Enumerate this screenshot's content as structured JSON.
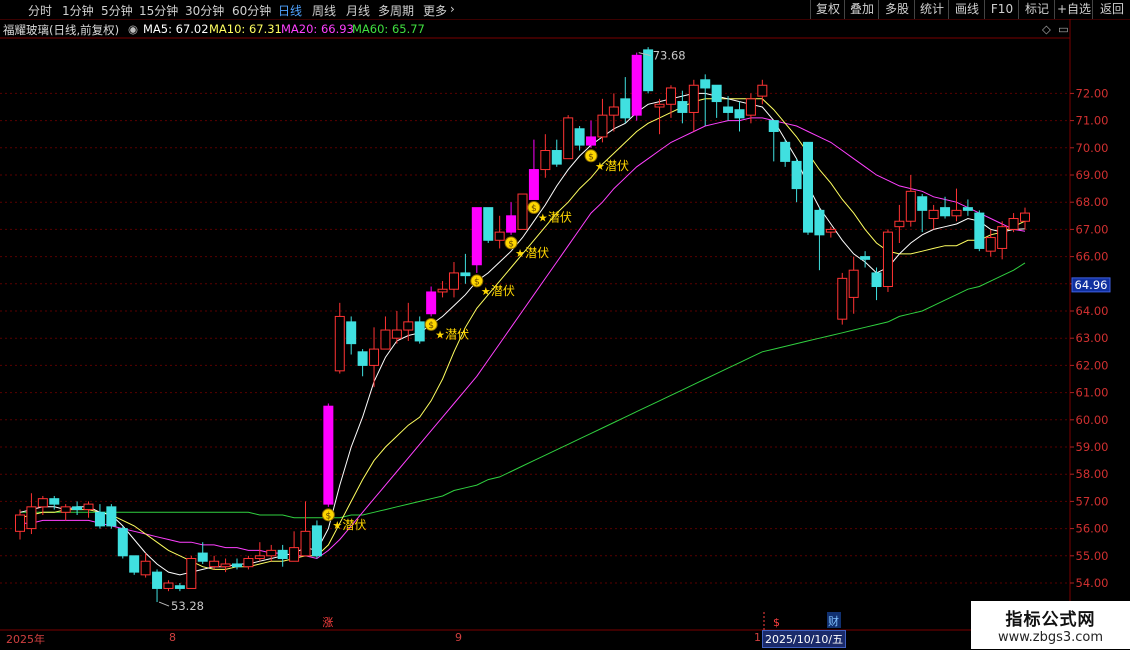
{
  "toolbar": {
    "period_tabs": [
      "分时",
      "1分钟",
      "5分钟",
      "15分钟",
      "30分钟",
      "60分钟",
      "日线",
      "周线",
      "月线",
      "多周期",
      "更多"
    ],
    "active_tab": "日线",
    "right_buttons": [
      "复权",
      "叠加",
      "多股",
      "统计",
      "画线",
      "F10",
      "标记",
      "+自选",
      "返回"
    ]
  },
  "stock": {
    "title": "福耀玻璃(日线,前复权)"
  },
  "ma_legend": [
    {
      "label": "MA5: 67.02",
      "color": "#ffffff"
    },
    {
      "label": "MA10: 67.31",
      "color": "#ffff60"
    },
    {
      "label": "MA20: 66.93",
      "color": "#ff40ff"
    },
    {
      "label": "MA60: 65.77",
      "color": "#40e040"
    }
  ],
  "price_axis": {
    "labels": [
      "72.00",
      "71.00",
      "70.00",
      "69.00",
      "68.00",
      "67.00",
      "66.00",
      "65.00",
      "64.00",
      "63.00",
      "62.00",
      "61.00",
      "60.00",
      "59.00",
      "58.00",
      "57.00",
      "56.00",
      "55.00",
      "54.00"
    ],
    "current_price": "64.96"
  },
  "annotations": {
    "high_label": "73.68",
    "low_label": "53.28",
    "signal_label": "潜伏",
    "zhang_label": "涨",
    "cai_label": "财",
    "s_label": "$"
  },
  "date_axis": {
    "labels": [
      "2025年",
      "8",
      "9",
      "1"
    ],
    "cursor_date": "2025/10/10/五"
  },
  "watermark": {
    "line1": "指标公式网",
    "line2": "www.zbgs3.com"
  },
  "colors": {
    "up": "#ff3333",
    "down": "#40e0e0",
    "highlight": "#ff00ff",
    "signal": "#ffd700"
  },
  "chart_data": {
    "type": "candlestick",
    "title": "福耀玻璃(日线,前复权)",
    "ylim": [
      53.5,
      73.9
    ],
    "candles": [
      {
        "o": 55.9,
        "c": 56.5,
        "h": 56.7,
        "l": 55.6
      },
      {
        "o": 56.0,
        "c": 56.8,
        "h": 57.3,
        "l": 55.8
      },
      {
        "o": 56.8,
        "c": 57.1,
        "h": 57.2,
        "l": 56.5
      },
      {
        "o": 57.1,
        "c": 56.9,
        "h": 57.2,
        "l": 56.7
      },
      {
        "o": 56.6,
        "c": 56.8,
        "h": 56.9,
        "l": 56.3
      },
      {
        "o": 56.8,
        "c": 56.7,
        "h": 57.0,
        "l": 56.5
      },
      {
        "o": 56.7,
        "c": 56.9,
        "h": 57.0,
        "l": 56.4
      },
      {
        "o": 56.6,
        "c": 56.1,
        "h": 56.9,
        "l": 56.0
      },
      {
        "o": 56.8,
        "c": 56.1,
        "h": 56.9,
        "l": 56.0
      },
      {
        "o": 56.0,
        "c": 55.0,
        "h": 56.1,
        "l": 54.9
      },
      {
        "o": 55.0,
        "c": 54.4,
        "h": 55.0,
        "l": 54.3
      },
      {
        "o": 54.3,
        "c": 54.8,
        "h": 55.1,
        "l": 54.2
      },
      {
        "o": 54.4,
        "c": 53.8,
        "h": 54.5,
        "l": 53.3
      },
      {
        "o": 53.8,
        "c": 54.0,
        "h": 54.1,
        "l": 53.7
      },
      {
        "o": 53.9,
        "c": 53.8,
        "h": 54.0,
        "l": 53.7
      },
      {
        "o": 53.8,
        "c": 54.9,
        "h": 55.0,
        "l": 53.8
      },
      {
        "o": 55.1,
        "c": 54.8,
        "h": 55.5,
        "l": 54.7
      },
      {
        "o": 54.6,
        "c": 54.8,
        "h": 55.0,
        "l": 54.5
      },
      {
        "o": 54.6,
        "c": 54.7,
        "h": 54.9,
        "l": 54.4
      },
      {
        "o": 54.7,
        "c": 54.6,
        "h": 54.9,
        "l": 54.5
      },
      {
        "o": 54.6,
        "c": 54.9,
        "h": 55.0,
        "l": 54.5
      },
      {
        "o": 54.9,
        "c": 55.0,
        "h": 55.5,
        "l": 54.8
      },
      {
        "o": 55.0,
        "c": 55.2,
        "h": 55.4,
        "l": 54.8
      },
      {
        "o": 55.2,
        "c": 54.9,
        "h": 55.4,
        "l": 54.6
      },
      {
        "o": 54.8,
        "c": 55.3,
        "h": 55.9,
        "l": 54.8
      },
      {
        "o": 55.0,
        "c": 55.9,
        "h": 57.0,
        "l": 55.0
      },
      {
        "o": 56.1,
        "c": 55.0,
        "h": 56.3,
        "l": 54.9
      },
      {
        "o": 56.9,
        "c": 60.5,
        "h": 60.6,
        "l": 56.8
      },
      {
        "o": 61.8,
        "c": 63.8,
        "h": 64.3,
        "l": 61.7
      },
      {
        "o": 63.6,
        "c": 62.8,
        "h": 63.8,
        "l": 62.4
      },
      {
        "o": 62.5,
        "c": 62.0,
        "h": 62.6,
        "l": 61.6
      },
      {
        "o": 62.0,
        "c": 62.6,
        "h": 63.4,
        "l": 61.2
      },
      {
        "o": 62.6,
        "c": 63.3,
        "h": 63.8,
        "l": 62.6
      },
      {
        "o": 63.0,
        "c": 63.3,
        "h": 64.0,
        "l": 62.8
      },
      {
        "o": 63.3,
        "c": 63.6,
        "h": 64.3,
        "l": 62.9
      },
      {
        "o": 63.6,
        "c": 62.9,
        "h": 63.8,
        "l": 62.8
      },
      {
        "o": 63.9,
        "c": 64.7,
        "h": 64.9,
        "l": 63.8
      },
      {
        "o": 64.7,
        "c": 64.8,
        "h": 65.1,
        "l": 64.5
      },
      {
        "o": 64.8,
        "c": 65.4,
        "h": 65.8,
        "l": 64.5
      },
      {
        "o": 65.4,
        "c": 65.3,
        "h": 66.1,
        "l": 65.0
      },
      {
        "o": 65.7,
        "c": 67.8,
        "h": 67.8,
        "l": 65.4
      },
      {
        "o": 67.8,
        "c": 66.6,
        "h": 67.8,
        "l": 66.5
      },
      {
        "o": 66.6,
        "c": 66.9,
        "h": 67.5,
        "l": 66.3
      },
      {
        "o": 66.9,
        "c": 67.5,
        "h": 68.0,
        "l": 66.8
      },
      {
        "o": 67.0,
        "c": 68.3,
        "h": 68.3,
        "l": 67.0
      },
      {
        "o": 68.1,
        "c": 69.2,
        "h": 70.3,
        "l": 68.1
      },
      {
        "o": 69.2,
        "c": 69.9,
        "h": 70.5,
        "l": 68.9
      },
      {
        "o": 69.9,
        "c": 69.4,
        "h": 70.3,
        "l": 69.3
      },
      {
        "o": 69.6,
        "c": 71.1,
        "h": 71.2,
        "l": 69.6
      },
      {
        "o": 70.7,
        "c": 70.1,
        "h": 70.8,
        "l": 69.9
      },
      {
        "o": 70.1,
        "c": 70.4,
        "h": 71.0,
        "l": 70.0
      },
      {
        "o": 70.4,
        "c": 71.2,
        "h": 71.8,
        "l": 70.2
      },
      {
        "o": 71.2,
        "c": 71.5,
        "h": 72.0,
        "l": 70.6
      },
      {
        "o": 71.8,
        "c": 71.1,
        "h": 72.6,
        "l": 70.9
      },
      {
        "o": 71.2,
        "c": 73.4,
        "h": 73.5,
        "l": 71.0
      },
      {
        "o": 73.6,
        "c": 72.1,
        "h": 73.7,
        "l": 72.0
      },
      {
        "o": 71.5,
        "c": 71.6,
        "h": 71.8,
        "l": 70.5
      },
      {
        "o": 71.6,
        "c": 72.2,
        "h": 72.3,
        "l": 71.1
      },
      {
        "o": 71.7,
        "c": 71.3,
        "h": 72.1,
        "l": 70.9
      },
      {
        "o": 71.3,
        "c": 72.3,
        "h": 72.5,
        "l": 70.6
      },
      {
        "o": 72.5,
        "c": 72.2,
        "h": 72.7,
        "l": 70.8
      },
      {
        "o": 72.3,
        "c": 71.7,
        "h": 72.3,
        "l": 71.1
      },
      {
        "o": 71.5,
        "c": 71.3,
        "h": 71.9,
        "l": 71.0
      },
      {
        "o": 71.4,
        "c": 71.1,
        "h": 71.7,
        "l": 70.6
      },
      {
        "o": 71.2,
        "c": 71.8,
        "h": 72.0,
        "l": 70.9
      },
      {
        "o": 71.9,
        "c": 72.3,
        "h": 72.5,
        "l": 71.6
      },
      {
        "o": 71.0,
        "c": 70.6,
        "h": 71.0,
        "l": 69.5
      },
      {
        "o": 70.2,
        "c": 69.5,
        "h": 70.3,
        "l": 69.3
      },
      {
        "o": 69.5,
        "c": 68.5,
        "h": 69.6,
        "l": 68.0
      },
      {
        "o": 70.2,
        "c": 66.9,
        "h": 70.2,
        "l": 66.8
      },
      {
        "o": 67.7,
        "c": 66.8,
        "h": 67.8,
        "l": 65.5
      },
      {
        "o": 66.9,
        "c": 67.0,
        "h": 67.1,
        "l": 66.7
      },
      {
        "o": 63.7,
        "c": 65.2,
        "h": 65.4,
        "l": 63.5
      },
      {
        "o": 64.5,
        "c": 65.5,
        "h": 66.0,
        "l": 63.9
      },
      {
        "o": 66.0,
        "c": 65.9,
        "h": 66.2,
        "l": 65.6
      },
      {
        "o": 65.4,
        "c": 64.9,
        "h": 65.6,
        "l": 64.4
      },
      {
        "o": 64.9,
        "c": 66.9,
        "h": 67.0,
        "l": 64.7
      },
      {
        "o": 67.1,
        "c": 67.3,
        "h": 67.9,
        "l": 66.5
      },
      {
        "o": 67.3,
        "c": 68.4,
        "h": 69.0,
        "l": 67.1
      },
      {
        "o": 68.2,
        "c": 67.7,
        "h": 68.3,
        "l": 66.9
      },
      {
        "o": 67.4,
        "c": 67.7,
        "h": 67.9,
        "l": 67.0
      },
      {
        "o": 67.8,
        "c": 67.5,
        "h": 68.2,
        "l": 67.4
      },
      {
        "o": 67.5,
        "c": 67.7,
        "h": 68.5,
        "l": 67.3
      },
      {
        "o": 67.8,
        "c": 67.7,
        "h": 68.1,
        "l": 67.5
      },
      {
        "o": 67.6,
        "c": 66.3,
        "h": 67.7,
        "l": 66.2
      },
      {
        "o": 66.2,
        "c": 66.7,
        "h": 67.0,
        "l": 66.0
      },
      {
        "o": 66.3,
        "c": 67.1,
        "h": 67.3,
        "l": 65.9
      },
      {
        "o": 67.0,
        "c": 67.4,
        "h": 67.6,
        "l": 66.9
      },
      {
        "o": 67.3,
        "c": 67.6,
        "h": 67.8,
        "l": 67.0
      }
    ],
    "ma5": [
      56.6,
      56.7,
      56.8,
      56.8,
      56.7,
      56.8,
      56.8,
      56.6,
      56.5,
      56.1,
      55.6,
      55.1,
      54.7,
      54.4,
      54.3,
      54.4,
      54.5,
      54.6,
      54.6,
      54.7,
      54.7,
      54.8,
      54.9,
      55.0,
      55.1,
      55.3,
      55.2,
      56.0,
      57.6,
      59.0,
      60.1,
      61.4,
      62.3,
      62.9,
      63.1,
      63.2,
      63.5,
      63.8,
      64.2,
      64.6,
      65.1,
      65.4,
      65.8,
      66.2,
      66.7,
      67.3,
      67.9,
      68.6,
      69.2,
      69.7,
      70.1,
      70.4,
      70.7,
      70.9,
      71.3,
      71.6,
      71.7,
      71.8,
      71.9,
      72.0,
      72.0,
      71.9,
      71.8,
      71.7,
      71.6,
      71.5,
      71.0,
      70.3,
      69.6,
      68.6,
      67.8,
      67.2,
      66.6,
      66.1,
      65.8,
      65.4,
      65.6,
      66.1,
      66.5,
      66.8,
      67.0,
      67.1,
      67.2,
      67.4,
      67.3,
      67.0,
      66.9,
      67.0,
      67.02
    ],
    "ma10": [
      56.4,
      56.5,
      56.6,
      56.6,
      56.7,
      56.7,
      56.7,
      56.6,
      56.5,
      56.3,
      56.1,
      55.8,
      55.5,
      55.2,
      55.0,
      54.8,
      54.6,
      54.5,
      54.5,
      54.6,
      54.6,
      54.7,
      54.8,
      54.8,
      54.9,
      55.0,
      55.0,
      55.4,
      56.2,
      57.0,
      57.8,
      58.5,
      59.0,
      59.4,
      59.8,
      60.1,
      60.7,
      61.5,
      62.5,
      63.4,
      64.1,
      64.6,
      65.1,
      65.6,
      66.1,
      66.6,
      67.1,
      67.6,
      68.0,
      68.5,
      68.9,
      69.4,
      69.8,
      70.2,
      70.6,
      70.9,
      71.1,
      71.3,
      71.5,
      71.7,
      71.8,
      71.8,
      71.8,
      71.8,
      71.8,
      71.8,
      71.4,
      70.9,
      70.4,
      69.8,
      69.2,
      68.7,
      68.1,
      67.6,
      67.0,
      66.5,
      66.2,
      66.1,
      66.1,
      66.2,
      66.3,
      66.4,
      66.4,
      66.6,
      66.6,
      66.8,
      66.9,
      67.1,
      67.31
    ],
    "ma20": [
      56.2,
      56.2,
      56.3,
      56.3,
      56.3,
      56.3,
      56.3,
      56.2,
      56.1,
      56.0,
      55.9,
      55.8,
      55.7,
      55.6,
      55.5,
      55.5,
      55.4,
      55.4,
      55.3,
      55.3,
      55.2,
      55.2,
      55.1,
      55.1,
      55.0,
      55.0,
      54.9,
      55.2,
      55.6,
      56.1,
      56.6,
      57.1,
      57.6,
      58.1,
      58.6,
      59.1,
      59.6,
      60.1,
      60.6,
      61.1,
      61.6,
      62.2,
      62.8,
      63.4,
      64.0,
      64.6,
      65.2,
      65.8,
      66.4,
      67.0,
      67.6,
      68.0,
      68.5,
      68.9,
      69.3,
      69.6,
      69.9,
      70.2,
      70.4,
      70.6,
      70.8,
      70.9,
      71.0,
      71.0,
      71.1,
      71.1,
      71.0,
      70.9,
      70.8,
      70.6,
      70.4,
      70.2,
      69.9,
      69.6,
      69.3,
      69.0,
      68.8,
      68.6,
      68.5,
      68.4,
      68.2,
      68.1,
      68.0,
      67.8,
      67.6,
      67.4,
      67.2,
      67.0,
      66.93
    ],
    "ma60": [
      56.6,
      56.6,
      56.6,
      56.6,
      56.6,
      56.6,
      56.6,
      56.6,
      56.6,
      56.6,
      56.6,
      56.6,
      56.6,
      56.6,
      56.6,
      56.6,
      56.6,
      56.6,
      56.6,
      56.6,
      56.6,
      56.5,
      56.5,
      56.5,
      56.4,
      56.4,
      56.4,
      56.4,
      56.4,
      56.5,
      56.5,
      56.6,
      56.7,
      56.8,
      56.9,
      57.0,
      57.1,
      57.2,
      57.4,
      57.5,
      57.6,
      57.8,
      57.9,
      58.1,
      58.3,
      58.5,
      58.7,
      58.9,
      59.1,
      59.3,
      59.5,
      59.7,
      59.9,
      60.1,
      60.3,
      60.5,
      60.7,
      60.9,
      61.1,
      61.3,
      61.5,
      61.7,
      61.9,
      62.1,
      62.3,
      62.5,
      62.6,
      62.7,
      62.8,
      62.9,
      63.0,
      63.1,
      63.2,
      63.3,
      63.4,
      63.5,
      63.6,
      63.8,
      63.9,
      64.0,
      64.2,
      64.4,
      64.6,
      64.8,
      64.9,
      65.1,
      65.3,
      65.5,
      65.77
    ],
    "signal_indices": [
      27,
      36,
      40,
      43,
      45,
      50
    ],
    "high_index": 54,
    "low_index": 12,
    "highlight_indices": [
      27,
      36,
      40,
      43,
      45,
      50,
      54
    ]
  }
}
